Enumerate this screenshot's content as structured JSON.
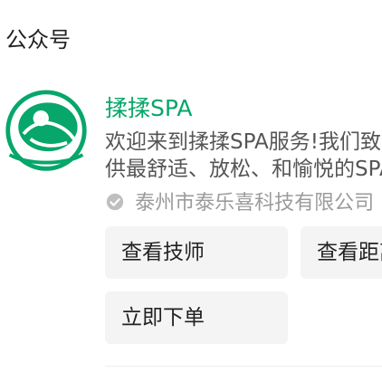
{
  "section": {
    "title": "公众号"
  },
  "account": {
    "name": "揉揉SPA",
    "description_lines": [
      "欢迎来到揉揉SPA服务!我们致力",
      "供最舒适、放松、和愉悦的SPA"
    ],
    "verified_entity": "泰州市泰乐喜科技有限公司",
    "brand_color": "#07a66a"
  },
  "actions": {
    "view_techs": "查看技师",
    "view_distance": "查看距离",
    "place_order": "立即下单"
  },
  "icons": {
    "logo": "spa-massage-logo",
    "verified": "verified-check-icon"
  }
}
